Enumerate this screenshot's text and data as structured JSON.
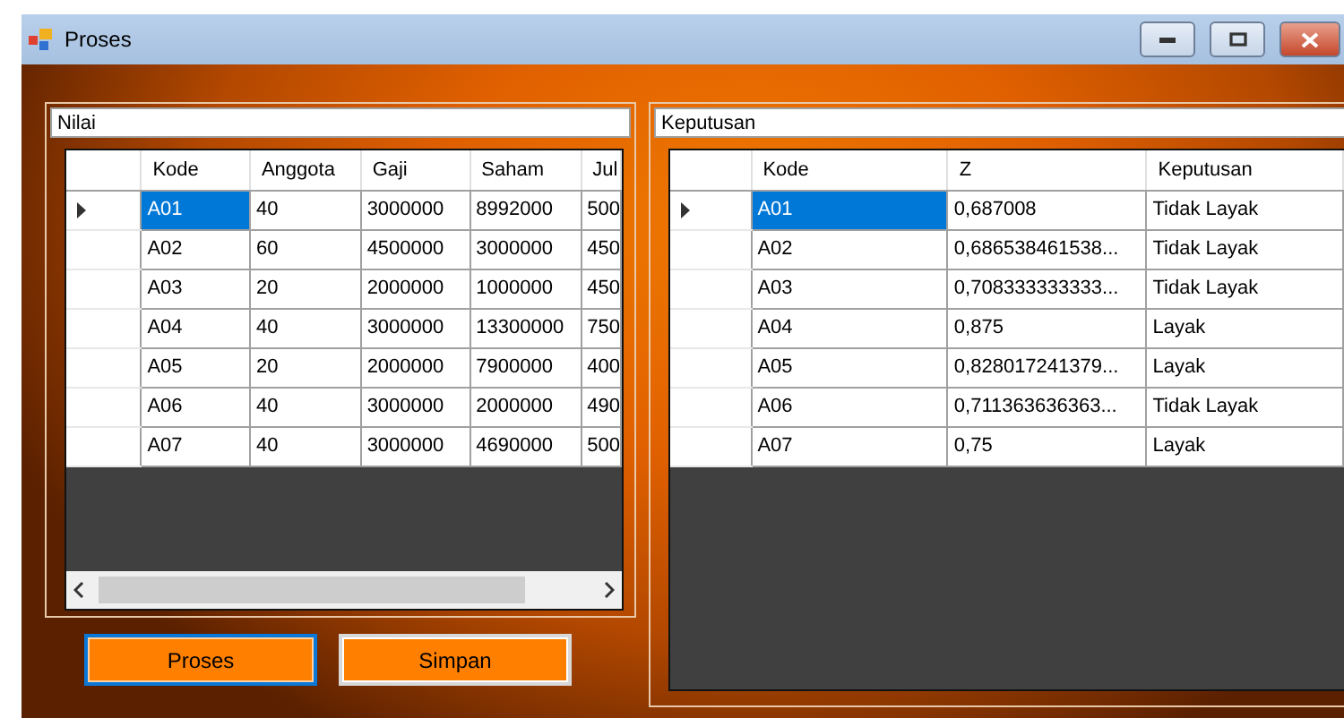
{
  "window": {
    "title": "Proses"
  },
  "nilai": {
    "caption": "Nilai",
    "columns": [
      "Kode",
      "Anggota",
      "Gaji",
      "Saham",
      "Jul"
    ],
    "rows": [
      {
        "selected": true,
        "cells": [
          "A01",
          "40",
          "3000000",
          "8992000",
          "500"
        ]
      },
      {
        "selected": false,
        "cells": [
          "A02",
          "60",
          "4500000",
          "3000000",
          "450"
        ]
      },
      {
        "selected": false,
        "cells": [
          "A03",
          "20",
          "2000000",
          "1000000",
          "450"
        ]
      },
      {
        "selected": false,
        "cells": [
          "A04",
          "40",
          "3000000",
          "13300000",
          "750"
        ]
      },
      {
        "selected": false,
        "cells": [
          "A05",
          "20",
          "2000000",
          "7900000",
          "400"
        ]
      },
      {
        "selected": false,
        "cells": [
          "A06",
          "40",
          "3000000",
          "2000000",
          "490"
        ]
      },
      {
        "selected": false,
        "cells": [
          "A07",
          "40",
          "3000000",
          "4690000",
          "500"
        ]
      }
    ]
  },
  "keputusan": {
    "caption": "Keputusan",
    "columns": [
      "Kode",
      "Z",
      "Keputusan"
    ],
    "rows": [
      {
        "selected": true,
        "cells": [
          "A01",
          "0,687008",
          "Tidak Layak"
        ]
      },
      {
        "selected": false,
        "cells": [
          "A02",
          "0,686538461538...",
          "Tidak Layak"
        ]
      },
      {
        "selected": false,
        "cells": [
          "A03",
          "0,708333333333...",
          "Tidak Layak"
        ]
      },
      {
        "selected": false,
        "cells": [
          "A04",
          "0,875",
          "Layak"
        ]
      },
      {
        "selected": false,
        "cells": [
          "A05",
          "0,828017241379...",
          "Layak"
        ]
      },
      {
        "selected": false,
        "cells": [
          "A06",
          "0,711363636363...",
          "Tidak Layak"
        ]
      },
      {
        "selected": false,
        "cells": [
          "A07",
          "0,75",
          "Layak"
        ]
      }
    ]
  },
  "buttons": [
    {
      "label": "Proses",
      "focused": true
    },
    {
      "label": "Simpan",
      "focused": false
    }
  ]
}
